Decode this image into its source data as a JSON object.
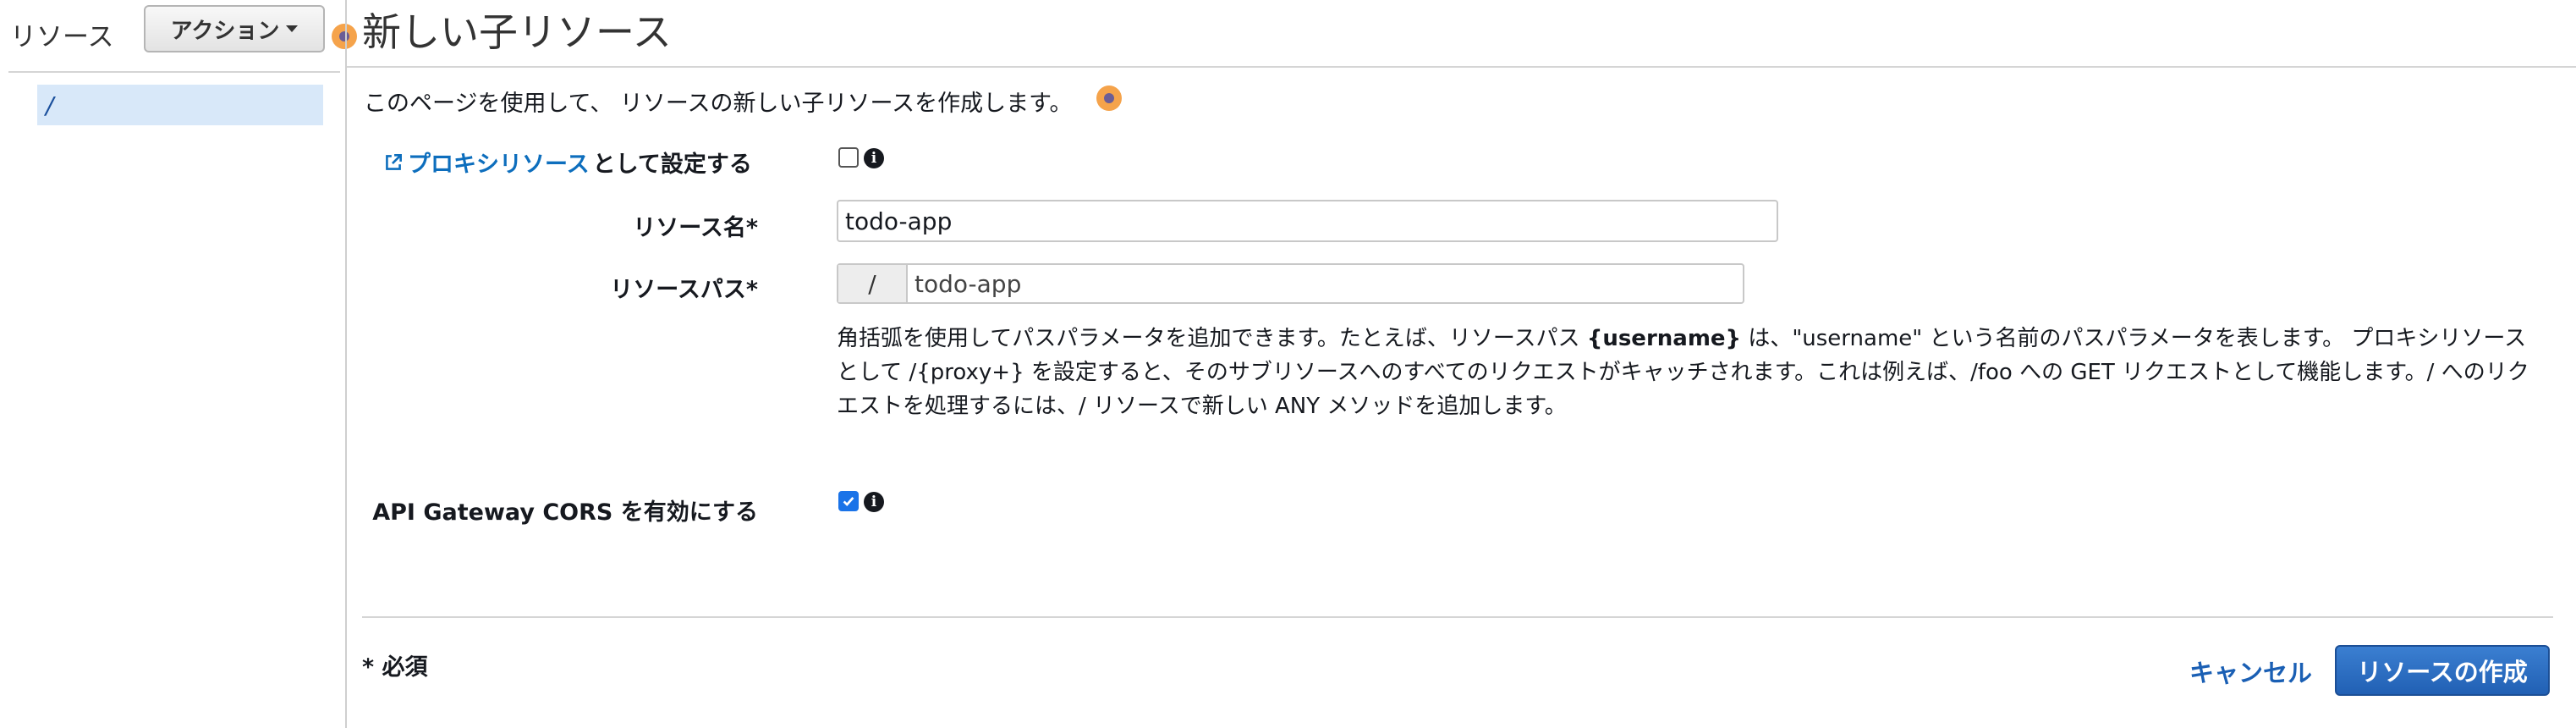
{
  "sidebar": {
    "title": "リソース",
    "actions_label": "アクション",
    "tree_items": [
      "/"
    ]
  },
  "main": {
    "title": "新しい子リソース",
    "description": "このページを使用して、 リソースの新しい子リソースを作成します。",
    "proxy": {
      "link_text": "プロキシリソース",
      "suffix_text": "として設定する",
      "checked": false
    },
    "resource_name": {
      "label": "リソース名*",
      "value": "todo-app"
    },
    "resource_path": {
      "label": "リソースパス*",
      "prefix": "/",
      "value": "todo-app"
    },
    "help": {
      "part1": "角括弧を使用してパスパラメータを追加できます。たとえば、リソースパス ",
      "bold1": "{username}",
      "part2": " は、\"username\" という名前のパスパラメータを表します。 プロキシリソースとして /{proxy+} を設定すると、そのサブリソースへのすべてのリクエストがキャッチされます。これは例えば、/foo への GET リクエストとして機能します。/ へのリクエストを処理するには、/ リソースで新しい ANY メソッドを追加します。"
    },
    "cors": {
      "label": "API Gateway CORS を有効にする",
      "checked": true
    },
    "required_note": "* 必須",
    "cancel_label": "キャンセル",
    "create_label": "リソースの作成"
  },
  "colors": {
    "primary_button": "#2160b4",
    "link": "#0d6ebd",
    "selected_tree_bg": "#d8e8f9",
    "help_dot": "#f5a34b"
  },
  "icons": [
    "help-dot-icon",
    "external-link-icon",
    "info-icon",
    "caret-down-icon"
  ]
}
